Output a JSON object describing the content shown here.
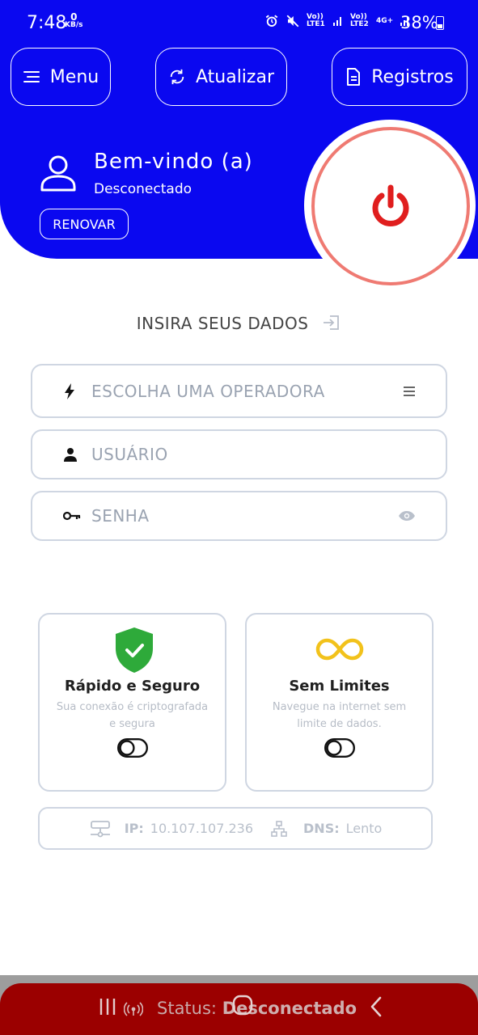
{
  "status_bar": {
    "time": "7:48",
    "net_speed_value": "0",
    "net_speed_unit": "KB/s",
    "sim1_label": "Vo)) LTE1",
    "sim2_label": "Vo)) LTE2",
    "data_label": "4G+",
    "battery": "38%"
  },
  "header": {
    "menu_label": "Menu",
    "refresh_label": "Atualizar",
    "logs_label": "Registros",
    "welcome_title": "Bem-vindo (a)",
    "connection_status": "Desconectado",
    "renew_label": "RENOVAR"
  },
  "form": {
    "section_title": "INSIRA SEUS DADOS",
    "operator_placeholder": "ESCOLHA UMA OPERADORA",
    "user_placeholder": "USUÁRIO",
    "password_placeholder": "SENHA"
  },
  "cards": [
    {
      "title": "Rápido e Seguro",
      "desc_line1": "Sua conexão é criptografada",
      "desc_line2": "e segura"
    },
    {
      "title": "Sem Limites",
      "desc_line1": "Navegue na internet sem",
      "desc_line2": "limite de dados."
    }
  ],
  "info": {
    "ip_label": "IP:",
    "ip_value": "10.107.107.236",
    "dns_label": "DNS:",
    "dns_value": "Lento"
  },
  "bottom": {
    "status_label": "Status:",
    "status_value": "Desconectado"
  },
  "colors": {
    "brand_blue": "#0a08f0",
    "power_red": "#e01e1e",
    "ring_red": "#ef7a72",
    "shield_green": "#2eaa3a",
    "infinity_yellow": "#f2c21b",
    "status_bar_red": "#9b0000"
  }
}
